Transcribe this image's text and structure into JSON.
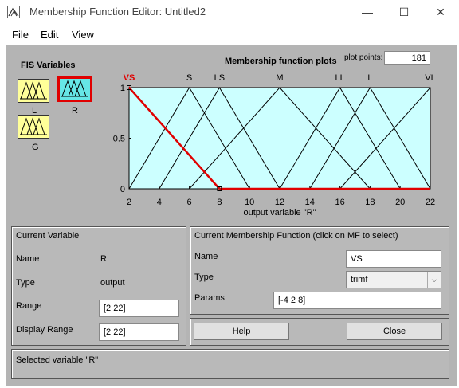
{
  "window": {
    "title": "Membership Function Editor: Untitled2",
    "controls": {
      "minimize": "—",
      "maximize": "☐",
      "close": "✕"
    }
  },
  "menu": [
    "File",
    "Edit",
    "View"
  ],
  "fis_variables": {
    "heading": "FIS Variables",
    "items": [
      {
        "label": "L",
        "type": "input"
      },
      {
        "label": "R",
        "type": "output",
        "selected": true
      },
      {
        "label": "G",
        "type": "input"
      }
    ]
  },
  "plot": {
    "title": "Membership function plots",
    "plot_points_label": "plot points:",
    "plot_points_value": "181"
  },
  "chart_data": {
    "type": "line",
    "xlabel": "output variable \"R\"",
    "xlim": [
      2,
      22
    ],
    "ylim": [
      0,
      1
    ],
    "x_ticks": [
      2,
      4,
      6,
      8,
      10,
      12,
      14,
      16,
      18,
      20,
      22
    ],
    "y_ticks": [
      0,
      0.5,
      1
    ],
    "series": [
      {
        "name": "VS",
        "points": [
          [
            -4,
            0
          ],
          [
            2,
            1
          ],
          [
            8,
            0
          ]
        ],
        "highlight": true
      },
      {
        "name": "S",
        "points": [
          [
            2,
            0
          ],
          [
            6,
            1
          ],
          [
            10,
            0
          ]
        ]
      },
      {
        "name": "LS",
        "points": [
          [
            4,
            0
          ],
          [
            8,
            1
          ],
          [
            12,
            0
          ]
        ]
      },
      {
        "name": "M",
        "points": [
          [
            6,
            0
          ],
          [
            12,
            1
          ],
          [
            18,
            0
          ]
        ]
      },
      {
        "name": "LL",
        "points": [
          [
            12,
            0
          ],
          [
            16,
            1
          ],
          [
            20,
            0
          ]
        ]
      },
      {
        "name": "L",
        "points": [
          [
            14,
            0
          ],
          [
            18,
            1
          ],
          [
            22,
            0
          ]
        ]
      },
      {
        "name": "VL",
        "points": [
          [
            16,
            0
          ],
          [
            22,
            1
          ],
          [
            28,
            0
          ]
        ]
      }
    ],
    "colors": {
      "plot_bg": "#ccffff",
      "line": "#000000",
      "highlight": "#e00000"
    }
  },
  "current_variable": {
    "heading": "Current Variable",
    "name_label": "Name",
    "name_value": "R",
    "type_label": "Type",
    "type_value": "output",
    "range_label": "Range",
    "range_value": "[2 22]",
    "display_range_label": "Display Range",
    "display_range_value": "[2 22]"
  },
  "current_mf": {
    "heading": "Current Membership Function (click on MF to select)",
    "name_label": "Name",
    "name_value": "VS",
    "type_label": "Type",
    "type_value": "trimf",
    "params_label": "Params",
    "params_value": "[-4 2 8]"
  },
  "buttons": {
    "help": "Help",
    "close": "Close"
  },
  "status": "Selected variable \"R\""
}
